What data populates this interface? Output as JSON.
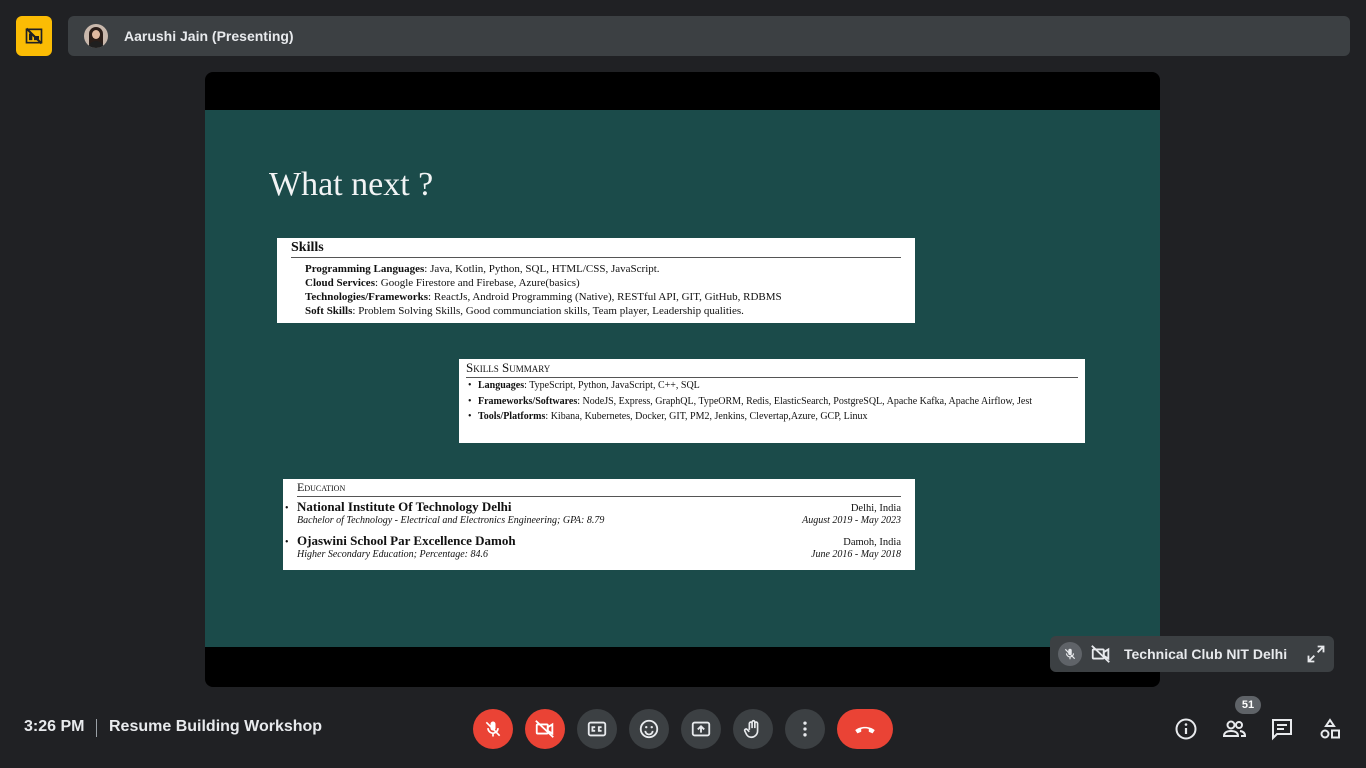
{
  "colors": {
    "accent": "#fbbc04",
    "danger": "#ea4335",
    "slide_bg": "#1b4b4a"
  },
  "presenter": {
    "name": "Aarushi Jain (Presenting)"
  },
  "slide": {
    "title": "What next ?",
    "skills": {
      "heading": "Skills",
      "rows": [
        {
          "label": "Programming Languages",
          "value": ": Java, Kotlin, Python, SQL, HTML/CSS, JavaScript."
        },
        {
          "label": "Cloud Services",
          "value": ": Google Firestore and Firebase, Azure(basics)"
        },
        {
          "label": "Technologies/Frameworks",
          "value": ": ReactJs, Android Programming (Native), RESTful API, GIT, GitHub, RDBMS"
        },
        {
          "label": "Soft Skills",
          "value": ": Problem Solving Skills, Good communciation skills, Team player, Leadership qualities."
        }
      ]
    },
    "summary": {
      "heading": "Skills Summary",
      "items": [
        {
          "label": "Languages",
          "value": ": TypeScript, Python, JavaScript, C++, SQL"
        },
        {
          "label": "Frameworks/Softwares",
          "value": ": NodeJS, Express, GraphQL, TypeORM, Redis, ElasticSearch, PostgreSQL, Apache Kafka, Apache Airflow, Jest"
        },
        {
          "label": "Tools/Platforms",
          "value": ": Kibana, Kubernetes, Docker, GIT, PM2, Jenkins, Clevertap,Azure, GCP, Linux"
        }
      ]
    },
    "education": {
      "heading": "Education",
      "entries": [
        {
          "school": "National Institute Of Technology Delhi",
          "place": "Delhi, India",
          "degree": "Bachelor of Technology - Electrical and Electronics Engineering; GPA: 8.79",
          "dates": "August 2019 - May 2023"
        },
        {
          "school": "Ojaswini School Par Excellence Damoh",
          "place": "Damoh, India",
          "degree": "Higher Secondary Education; Percentage: 84.6",
          "dates": "June 2016 - May 2018"
        }
      ]
    }
  },
  "self_tile": {
    "name": "Technical Club NIT Delhi"
  },
  "footer": {
    "time": "3:26 PM",
    "meeting_title": "Resume Building Workshop",
    "participants_count": "51"
  },
  "icons": {
    "pin": "layout-off-icon",
    "mic": "mic-off-icon",
    "cam": "videocam-off-icon",
    "cc": "closed-caption-icon",
    "emoji": "emoji-icon",
    "present": "present-screen-icon",
    "hand": "raise-hand-icon",
    "more": "more-vert-icon",
    "hangup": "call-end-icon",
    "info": "info-icon",
    "people": "people-icon",
    "chat": "chat-icon",
    "activities": "activities-icon",
    "expand": "expand-icon"
  }
}
